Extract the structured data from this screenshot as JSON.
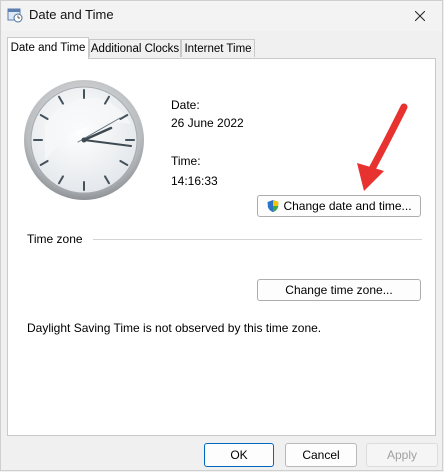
{
  "window": {
    "title": "Date and Time"
  },
  "tabs": [
    {
      "label": "Date and Time",
      "active": true
    },
    {
      "label": "Additional Clocks",
      "active": false
    },
    {
      "label": "Internet Time",
      "active": false
    }
  ],
  "datetime": {
    "date_label": "Date:",
    "date_value": "26 June 2022",
    "time_label": "Time:",
    "time_value": "14:16:33",
    "change_button": "Change date and time..."
  },
  "timezone": {
    "section_label": "Time zone",
    "change_button": "Change time zone...",
    "dst_note": "Daylight Saving Time is not observed by this time zone."
  },
  "footer": {
    "ok": "OK",
    "cancel": "Cancel",
    "apply": "Apply"
  },
  "colors": {
    "arrow": "#e8322f",
    "accent": "#0067c0"
  }
}
